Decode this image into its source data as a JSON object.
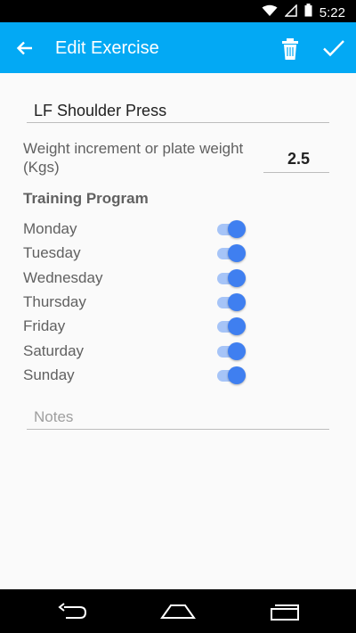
{
  "status_bar": {
    "time": "5:22"
  },
  "app_bar": {
    "title": "Edit Exercise"
  },
  "form": {
    "exercise_name": "LF Shoulder Press",
    "weight_label": "Weight increment or plate weight (Kgs)",
    "weight_value": "2.5",
    "program_title": "Training Program",
    "days": [
      {
        "label": "Monday",
        "enabled": true
      },
      {
        "label": "Tuesday",
        "enabled": true
      },
      {
        "label": "Wednesday",
        "enabled": true
      },
      {
        "label": "Thursday",
        "enabled": true
      },
      {
        "label": "Friday",
        "enabled": true
      },
      {
        "label": "Saturday",
        "enabled": true
      },
      {
        "label": "Sunday",
        "enabled": true
      }
    ],
    "notes_placeholder": "Notes"
  },
  "colors": {
    "app_bar": "#03a9f4",
    "toggle_on": "#3f7ff0",
    "toggle_track": "#a6c4f7"
  }
}
